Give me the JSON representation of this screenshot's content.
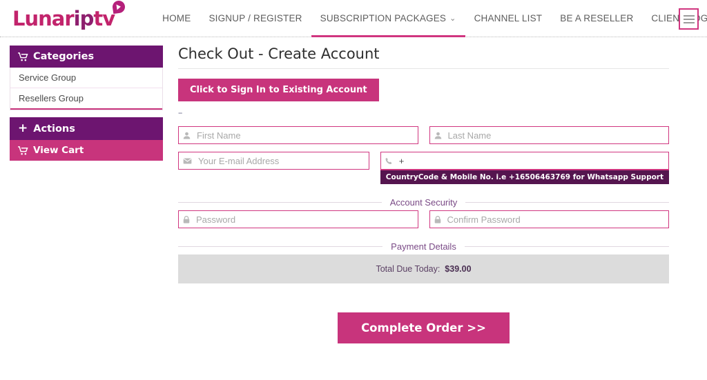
{
  "brand": {
    "name_part1": "Lunar",
    "name_part2": "ip",
    "name_part3": "tv",
    "bubble_icon": "play-bubble-icon",
    "accent_pink": "#c8347c",
    "accent_purple": "#6d1570",
    "accent_dark_purple": "#55154f"
  },
  "nav": {
    "items": [
      {
        "label": "HOME",
        "has_caret": false,
        "active": false
      },
      {
        "label": "SIGNUP / REGISTER",
        "has_caret": false,
        "active": false
      },
      {
        "label": "SUBSCRIPTION PACKAGES",
        "has_caret": true,
        "active": true
      },
      {
        "label": "CHANNEL LIST",
        "has_caret": false,
        "active": false
      },
      {
        "label": "BE A RESELLER",
        "has_caret": false,
        "active": false
      },
      {
        "label": "CLIENT LOGIN",
        "has_caret": true,
        "active": false
      }
    ],
    "caret_glyph": "⌄",
    "menu_button_icon": "hamburger-menu-icon"
  },
  "sidebar": {
    "categories": {
      "title": "Categories",
      "icon": "shopping-cart-icon",
      "items": [
        {
          "label": "Service Group"
        },
        {
          "label": "Resellers Group"
        }
      ]
    },
    "actions": {
      "title": "Actions",
      "icon": "plus-icon",
      "plus_glyph": "+",
      "items": [
        {
          "label": "View Cart",
          "icon": "shopping-cart-icon"
        }
      ]
    }
  },
  "main": {
    "title": "Check Out - Create Account",
    "signin_button": "Click to Sign In to Existing Account",
    "dash_note": "--",
    "fields": {
      "first_name": {
        "placeholder": "First Name",
        "value": "",
        "icon": "user-icon"
      },
      "last_name": {
        "placeholder": "Last Name",
        "value": "",
        "icon": "user-icon"
      },
      "email": {
        "placeholder": "Your E-mail Address",
        "value": "",
        "icon": "envelope-icon"
      },
      "phone": {
        "placeholder": "",
        "value": "+",
        "icon": "phone-icon"
      },
      "password": {
        "placeholder": "Password",
        "value": "",
        "icon": "lock-icon"
      },
      "confirm_password": {
        "placeholder": "Confirm Password",
        "value": "",
        "icon": "lock-icon"
      }
    },
    "phone_tooltip": "CountryCode & Mobile No. i.e +16506463769 for Whatsapp Support",
    "legends": {
      "account_security": "Account Security",
      "payment_details": "Payment Details"
    },
    "payment": {
      "total_label": "Total Due Today:",
      "total_value": "$39.00"
    },
    "complete_order_button": "Complete Order >>"
  }
}
